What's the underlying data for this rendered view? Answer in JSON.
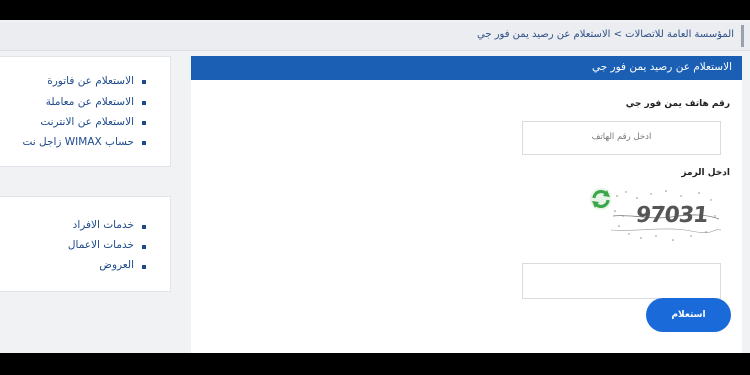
{
  "breadcrumb": {
    "text": "المؤسسة العامة للاتصالات > الاستعلام عن رصيد يمن فور جي"
  },
  "panel": {
    "header": "الاستعلام عن رصيد يمن فور جي",
    "phone_label": "رقم هاتف يمن فور جي",
    "phone_placeholder": "ادخل رقم الهاتف",
    "code_label": "ادخل الرمز",
    "captcha_text": "97031",
    "submit_label": "استعلام"
  },
  "sidebar": {
    "group1": [
      {
        "label": "الاستعلام عن فاتورة"
      },
      {
        "label": "الاستعلام عن معاملة"
      },
      {
        "label": "الاستعلام عن الانترنت"
      },
      {
        "label": "حساب WIMAX زاجل نت"
      }
    ],
    "group2": [
      {
        "label": "خدمات الافراد"
      },
      {
        "label": "خدمات الاعمال"
      },
      {
        "label": "العروض"
      }
    ]
  },
  "colors": {
    "header_blue": "#1a5fb4",
    "button_blue": "#1a6ad9",
    "link_blue": "#1e4a8a",
    "refresh_green": "#3aa64a"
  },
  "icons": {
    "refresh": "refresh-icon"
  }
}
